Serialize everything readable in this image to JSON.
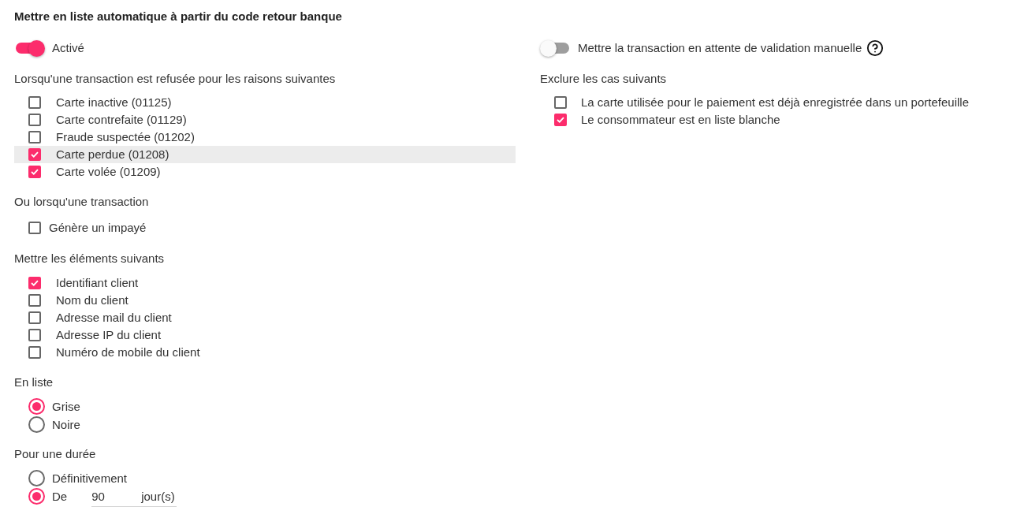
{
  "title": "Mettre en liste automatique à partir du code retour banque",
  "left": {
    "activation": {
      "label": "Activé",
      "on": true
    },
    "refusal_reasons": {
      "label": "Lorsqu'une transaction est refusée pour les raisons suivantes",
      "options": [
        {
          "label": "Carte inactive (01125)",
          "checked": false,
          "highlighted": false
        },
        {
          "label": "Carte contrefaite (01129)",
          "checked": false,
          "highlighted": false
        },
        {
          "label": "Fraude suspectée (01202)",
          "checked": false,
          "highlighted": false
        },
        {
          "label": "Carte perdue (01208)",
          "checked": true,
          "highlighted": true
        },
        {
          "label": "Carte volée (01209)",
          "checked": true,
          "highlighted": false
        }
      ]
    },
    "unpaid": {
      "label": "Ou lorsqu'une transaction",
      "options": [
        {
          "label": "Génère un impayé",
          "checked": false
        }
      ]
    },
    "elements": {
      "label": "Mettre les éléments suivants",
      "options": [
        {
          "label": "Identifiant client",
          "checked": true
        },
        {
          "label": "Nom du client",
          "checked": false
        },
        {
          "label": "Adresse mail du client",
          "checked": false
        },
        {
          "label": "Adresse IP du client",
          "checked": false
        },
        {
          "label": "Numéro de mobile du client",
          "checked": false
        }
      ]
    },
    "list_type": {
      "label": "En liste",
      "options": [
        {
          "label": "Grise",
          "selected": true
        },
        {
          "label": "Noire",
          "selected": false
        }
      ]
    },
    "duration": {
      "label": "Pour une durée",
      "options": [
        {
          "label": "Définitivement",
          "selected": false,
          "kind": "plain"
        },
        {
          "label": "De",
          "selected": true,
          "kind": "days",
          "field": {
            "value": "90",
            "suffix": "jour(s)"
          }
        }
      ]
    }
  },
  "right": {
    "manual_validation": {
      "label": "Mettre la transaction en attente de validation manuelle",
      "on": false
    },
    "exclusions": {
      "label": "Exclure les cas suivants",
      "options": [
        {
          "label": "La carte utilisée pour le paiement est déjà enregistrée dans un portefeuille",
          "checked": false
        },
        {
          "label": "Le consommateur est en liste blanche",
          "checked": true
        }
      ]
    }
  }
}
